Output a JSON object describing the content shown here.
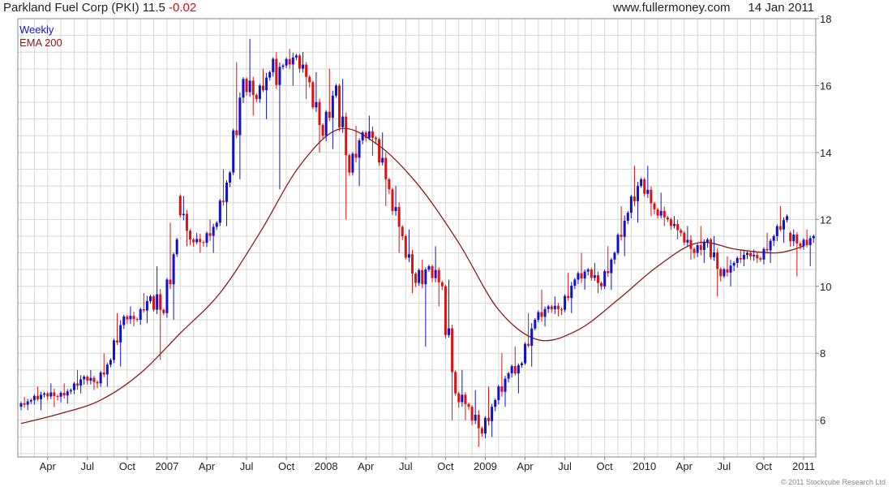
{
  "header": {
    "symbol_title": "Parkland Fuel Corp (PKI)",
    "price": "11.5",
    "change": "-0.02",
    "website": "www.fullermoney.com",
    "date": "14 Jan 2011"
  },
  "footer": {
    "copyright": "© 2011 Stockcube Research Ltd"
  },
  "colors": {
    "up": "#1111cc",
    "down": "#dd1111",
    "ema": "#8b1a1a",
    "grid": "#d8d8d8",
    "frame": "#888888"
  },
  "chart_data": {
    "type": "candlestick",
    "interval": "weekly",
    "legend": [
      "Weekly",
      "EMA 200"
    ],
    "legend_position": "top-left",
    "grid": true,
    "y_axis": {
      "side": "right",
      "range": [
        4.9,
        18
      ],
      "ticks": [
        6,
        8,
        10,
        12,
        14,
        16,
        18
      ]
    },
    "x_axis": {
      "start_month": "2006-02",
      "end_month": "2011-01",
      "tick_labels": [
        "Apr",
        "Jul",
        "Oct",
        "2007",
        "Apr",
        "Jul",
        "Oct",
        "2008",
        "Apr",
        "Jul",
        "Oct",
        "2009",
        "Apr",
        "Jul",
        "Oct",
        "2010",
        "Apr",
        "Jul",
        "Oct",
        "2011"
      ],
      "tick_months": [
        "2006-04",
        "2006-07",
        "2006-10",
        "2007-01",
        "2007-04",
        "2007-07",
        "2007-10",
        "2008-01",
        "2008-04",
        "2008-07",
        "2008-10",
        "2009-01",
        "2009-04",
        "2009-07",
        "2009-10",
        "2010-01",
        "2010-04",
        "2010-07",
        "2010-10",
        "2011-01"
      ]
    },
    "series": [
      {
        "name": "Weekly",
        "type": "candlestick",
        "points": [
          [
            "2006-02",
            6.4,
            6.7,
            6.3,
            6.6
          ],
          [
            "2006-03",
            6.6,
            7.0,
            6.3,
            6.8
          ],
          [
            "2006-04",
            6.8,
            7.1,
            6.4,
            6.7
          ],
          [
            "2006-05",
            6.7,
            7.1,
            6.5,
            6.9
          ],
          [
            "2006-06",
            6.9,
            7.5,
            6.8,
            7.3
          ],
          [
            "2006-07",
            7.3,
            7.5,
            6.9,
            7.1
          ],
          [
            "2006-08",
            7.1,
            8.0,
            7.0,
            7.8
          ],
          [
            "2006-09",
            7.8,
            9.2,
            7.6,
            9.1
          ],
          [
            "2006-10",
            9.1,
            9.4,
            8.8,
            9.0
          ],
          [
            "2006-11",
            9.0,
            9.8,
            8.9,
            9.7
          ],
          [
            "2006-12",
            9.7,
            10.6,
            7.8,
            9.2
          ],
          [
            "2007-01",
            9.2,
            11.9,
            9.0,
            11.4
          ],
          [
            "2007-02",
            12.7,
            12.7,
            11.2,
            11.4
          ],
          [
            "2007-03",
            11.4,
            11.6,
            11.0,
            11.3
          ],
          [
            "2007-04",
            11.3,
            12.0,
            11.0,
            11.9
          ],
          [
            "2007-05",
            11.9,
            13.5,
            11.8,
            13.4
          ],
          [
            "2007-06",
            13.4,
            16.7,
            13.2,
            16.2
          ],
          [
            "2007-07",
            16.2,
            17.4,
            15.1,
            15.6
          ],
          [
            "2007-08",
            15.6,
            16.5,
            15.0,
            16.4
          ],
          [
            "2007-09",
            16.4,
            17.0,
            12.9,
            16.6
          ],
          [
            "2007-10",
            16.6,
            17.1,
            16.0,
            16.9
          ],
          [
            "2007-11",
            16.9,
            17.0,
            15.6,
            16.1
          ],
          [
            "2007-12",
            16.1,
            16.4,
            14.0,
            14.5
          ],
          [
            "2008-01",
            14.5,
            16.5,
            14.1,
            16.0
          ],
          [
            "2008-02",
            16.0,
            16.2,
            12.0,
            13.4
          ],
          [
            "2008-03",
            13.4,
            14.8,
            13.0,
            14.6
          ],
          [
            "2008-04",
            14.6,
            15.1,
            13.9,
            14.4
          ],
          [
            "2008-05",
            14.4,
            14.6,
            12.4,
            12.9
          ],
          [
            "2008-06",
            12.9,
            13.0,
            11.0,
            11.5
          ],
          [
            "2008-07",
            11.5,
            11.7,
            9.8,
            10.1
          ],
          [
            "2008-08",
            10.1,
            10.8,
            8.2,
            10.6
          ],
          [
            "2008-09",
            10.6,
            11.2,
            9.4,
            10.0
          ],
          [
            "2008-10",
            10.0,
            10.2,
            6.0,
            6.8
          ],
          [
            "2008-11",
            6.8,
            7.5,
            6.0,
            6.4
          ],
          [
            "2008-12",
            6.4,
            6.9,
            5.2,
            5.6
          ],
          [
            "2009-01",
            5.6,
            7.0,
            5.5,
            6.6
          ],
          [
            "2009-02",
            6.6,
            8.0,
            6.4,
            7.4
          ],
          [
            "2009-03",
            7.4,
            8.2,
            6.8,
            7.7
          ],
          [
            "2009-04",
            7.7,
            9.2,
            7.6,
            9.0
          ],
          [
            "2009-05",
            9.0,
            9.9,
            8.8,
            9.4
          ],
          [
            "2009-06",
            9.4,
            9.7,
            9.1,
            9.3
          ],
          [
            "2009-07",
            9.3,
            10.4,
            9.2,
            10.2
          ],
          [
            "2009-08",
            10.2,
            11.0,
            9.9,
            10.5
          ],
          [
            "2009-09",
            10.5,
            10.7,
            9.8,
            10.0
          ],
          [
            "2009-10",
            10.0,
            11.2,
            9.9,
            11.0
          ],
          [
            "2009-11",
            11.0,
            12.4,
            10.9,
            12.2
          ],
          [
            "2009-12",
            12.2,
            13.6,
            11.9,
            13.2
          ],
          [
            "2010-01",
            13.2,
            13.6,
            12.1,
            12.3
          ],
          [
            "2010-02",
            12.3,
            12.8,
            11.8,
            12.0
          ],
          [
            "2010-03",
            12.0,
            12.1,
            11.4,
            11.6
          ],
          [
            "2010-04",
            11.6,
            11.8,
            10.8,
            11.0
          ],
          [
            "2010-05",
            11.0,
            11.8,
            10.7,
            11.4
          ],
          [
            "2010-06",
            11.4,
            11.5,
            9.7,
            10.3
          ],
          [
            "2010-07",
            10.3,
            10.9,
            10.0,
            10.7
          ],
          [
            "2010-08",
            10.7,
            11.1,
            10.6,
            11.0
          ],
          [
            "2010-09",
            11.0,
            11.1,
            10.7,
            10.8
          ],
          [
            "2010-10",
            10.8,
            11.6,
            10.7,
            11.5
          ],
          [
            "2010-11",
            11.5,
            12.4,
            11.3,
            12.1
          ],
          [
            "2010-12",
            11.6,
            11.7,
            10.3,
            11.2
          ],
          [
            "2011-01",
            11.2,
            11.7,
            10.6,
            11.5
          ]
        ]
      },
      {
        "name": "EMA 200",
        "type": "line",
        "points": [
          [
            "2006-02",
            5.9
          ],
          [
            "2006-05",
            6.2
          ],
          [
            "2006-08",
            6.6
          ],
          [
            "2006-11",
            7.4
          ],
          [
            "2007-02",
            8.6
          ],
          [
            "2007-05",
            9.8
          ],
          [
            "2007-08",
            11.6
          ],
          [
            "2007-11",
            13.6
          ],
          [
            "2008-02",
            14.7
          ],
          [
            "2008-05",
            14.2
          ],
          [
            "2008-08",
            13.0
          ],
          [
            "2008-11",
            11.3
          ],
          [
            "2009-02",
            9.3
          ],
          [
            "2009-05",
            8.4
          ],
          [
            "2009-08",
            8.7
          ],
          [
            "2009-11",
            9.6
          ],
          [
            "2010-02",
            10.6
          ],
          [
            "2010-05",
            11.3
          ],
          [
            "2010-08",
            11.1
          ],
          [
            "2010-11",
            11.0
          ],
          [
            "2011-01",
            11.2
          ]
        ]
      }
    ]
  }
}
